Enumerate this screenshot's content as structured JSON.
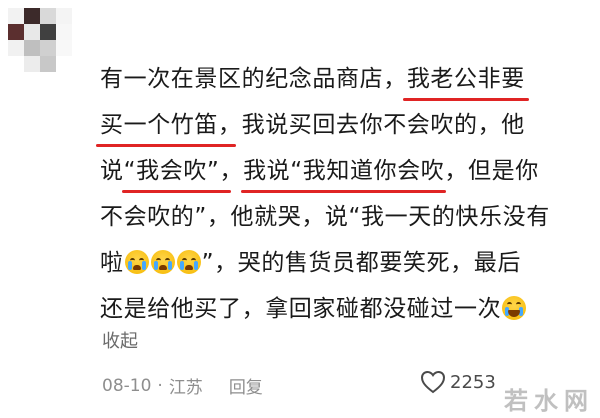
{
  "comment": {
    "lines": [
      [
        "有一次在景区的纪念品商店，",
        "我老公非要"
      ],
      [
        "买一个竹笛",
        "，我说买回去你不会吹的，他"
      ],
      [
        "说",
        "“我会吹”",
        "，",
        "我说“我知道你会吹",
        "，但是你"
      ],
      [
        "不会吹的”，他就哭，说“我一天的快乐没有"
      ],
      [
        "啦",
        "”，哭的售货员都要笑死，最后"
      ],
      [
        "还是给他买了，拿回家碰都没碰过一次"
      ]
    ],
    "emoji_crying": "loudly-crying-face-icon",
    "emoji_laughing": "rolling-laughing-face-icon"
  },
  "collapse_label": "收起",
  "meta": {
    "date": "08-10",
    "separator": "·",
    "location": "江苏",
    "reply_label": "回复"
  },
  "like": {
    "icon": "heart-outline-icon",
    "count": "2253"
  },
  "watermark": "若水网",
  "colors": {
    "underline": "#e02424",
    "secondary_text": "#8e8e8e"
  }
}
